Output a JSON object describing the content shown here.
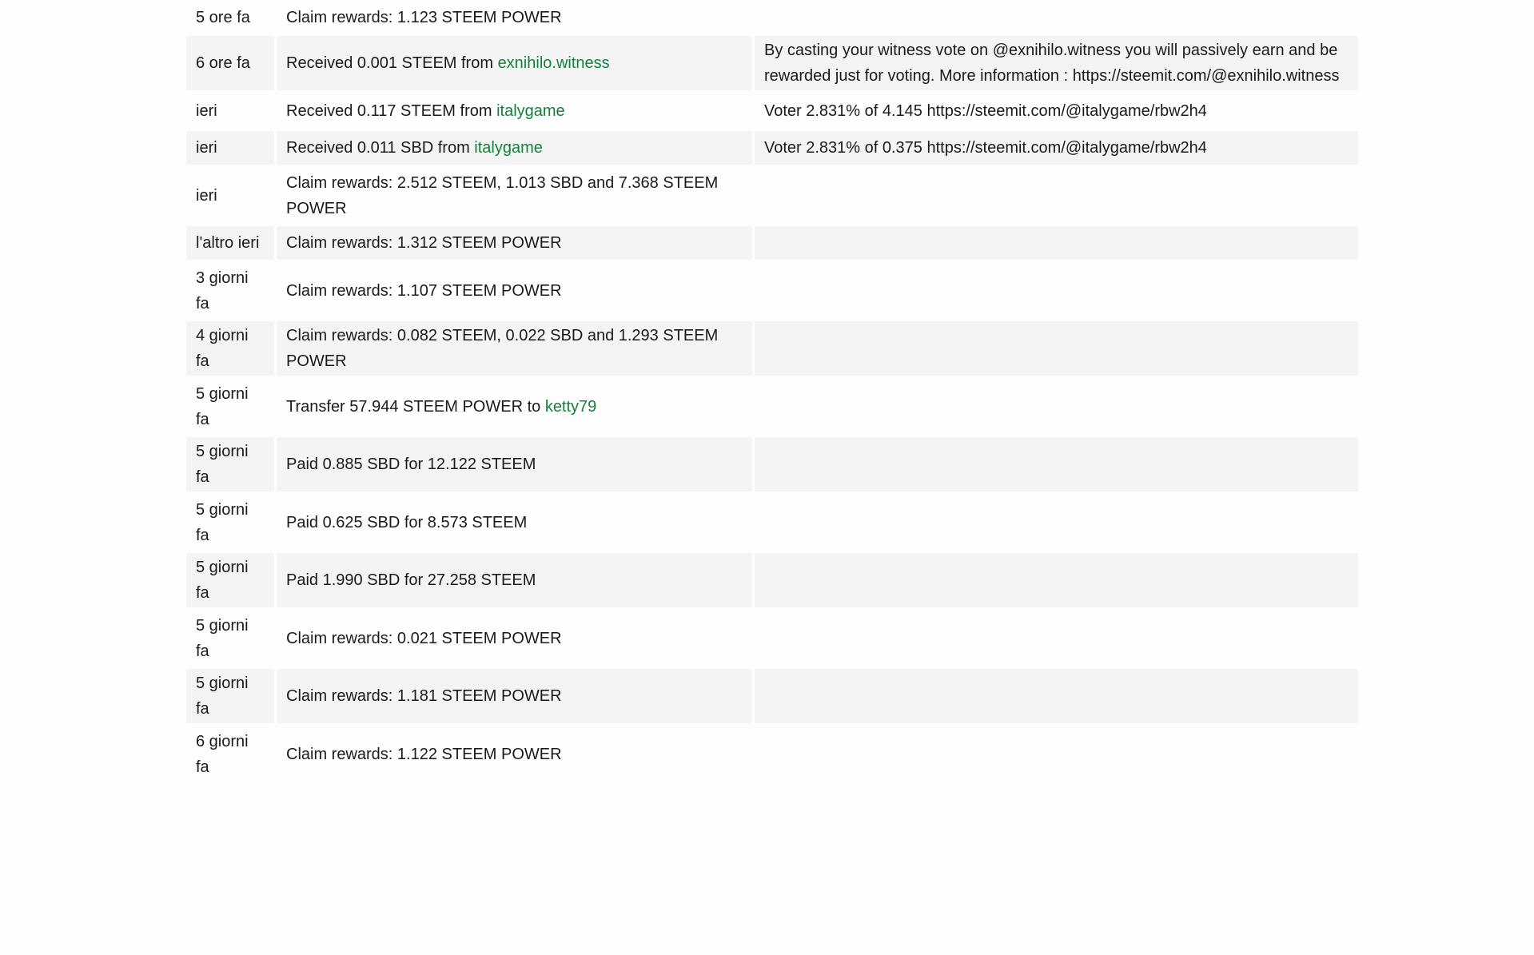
{
  "rows": [
    {
      "time": "5 ore fa",
      "op": {
        "text": "Claim rewards: 1.123 STEEM POWER",
        "account": "",
        "suffix": ""
      },
      "memo": ""
    },
    {
      "time": "6 ore fa",
      "op": {
        "text": "Received 0.001 STEEM from ",
        "account": "exnihilo.witness",
        "suffix": ""
      },
      "memo": "By casting your witness vote on @exnihilo.witness you will passively earn and be rewarded just for voting. More information : https://steemit.com/@exnihilo.witness"
    },
    {
      "time": "ieri",
      "op": {
        "text": "Received 0.117 STEEM from ",
        "account": "italygame",
        "suffix": ""
      },
      "memo": "Voter 2.831% of 4.145 https://steemit.com/@italygame/rbw2h4"
    },
    {
      "time": "ieri",
      "op": {
        "text": "Received 0.011 SBD from ",
        "account": "italygame",
        "suffix": ""
      },
      "memo": "Voter 2.831% of 0.375 https://steemit.com/@italygame/rbw2h4"
    },
    {
      "time": "ieri",
      "op": {
        "text": "Claim rewards: 2.512 STEEM, 1.013 SBD and 7.368 STEEM POWER",
        "account": "",
        "suffix": ""
      },
      "memo": ""
    },
    {
      "time": "l'altro ieri",
      "op": {
        "text": "Claim rewards: 1.312 STEEM POWER",
        "account": "",
        "suffix": ""
      },
      "memo": ""
    },
    {
      "time": "3 giorni fa",
      "op": {
        "text": "Claim rewards: 1.107 STEEM POWER",
        "account": "",
        "suffix": ""
      },
      "memo": ""
    },
    {
      "time": "4 giorni fa",
      "op": {
        "text": "Claim rewards: 0.082 STEEM, 0.022 SBD and 1.293 STEEM POWER",
        "account": "",
        "suffix": ""
      },
      "memo": ""
    },
    {
      "time": "5 giorni fa",
      "op": {
        "text": "Transfer 57.944 STEEM POWER to ",
        "account": "ketty79",
        "suffix": ""
      },
      "memo": ""
    },
    {
      "time": "5 giorni fa",
      "op": {
        "text": "Paid 0.885 SBD for 12.122 STEEM",
        "account": "",
        "suffix": ""
      },
      "memo": ""
    },
    {
      "time": "5 giorni fa",
      "op": {
        "text": "Paid 0.625 SBD for 8.573 STEEM",
        "account": "",
        "suffix": ""
      },
      "memo": ""
    },
    {
      "time": "5 giorni fa",
      "op": {
        "text": "Paid 1.990 SBD for 27.258 STEEM",
        "account": "",
        "suffix": ""
      },
      "memo": ""
    },
    {
      "time": "5 giorni fa",
      "op": {
        "text": "Claim rewards: 0.021 STEEM POWER",
        "account": "",
        "suffix": ""
      },
      "memo": ""
    },
    {
      "time": "5 giorni fa",
      "op": {
        "text": "Claim rewards: 1.181 STEEM POWER",
        "account": "",
        "suffix": ""
      },
      "memo": ""
    },
    {
      "time": "6 giorni fa",
      "op": {
        "text": "Claim rewards: 1.122 STEEM POWER",
        "account": "",
        "suffix": ""
      },
      "memo": ""
    }
  ]
}
